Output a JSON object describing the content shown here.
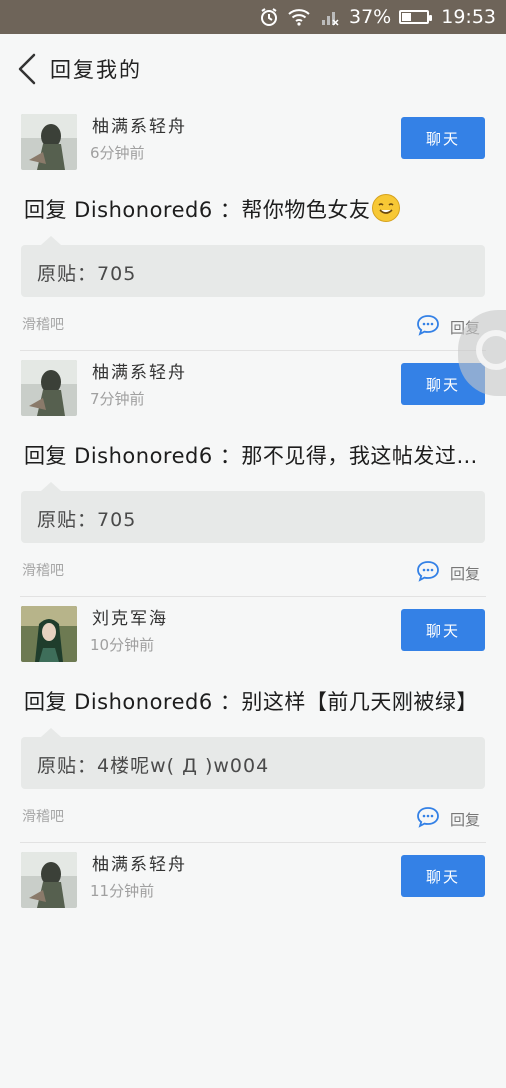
{
  "status_bar": {
    "battery_text": "37%",
    "battery_level": 0.37,
    "time": "19:53"
  },
  "header": {
    "title": "回复我的"
  },
  "items": [
    {
      "user": "柚满系轻舟",
      "time": "6分钟前",
      "chat_label": "聊天",
      "reply_prefix": "回复 Dishonored6 ：",
      "reply_body": "帮你物色女友",
      "orig_label": "原贴：",
      "orig_text": "705",
      "forum": "滑稽吧",
      "reply_label": "回复",
      "avatar": "grey"
    },
    {
      "user": "柚满系轻舟",
      "time": "7分钟前",
      "chat_label": "聊天",
      "reply_prefix": "回复 Dishonored6 ：",
      "reply_body": "那不见得，我这帖发过…",
      "orig_label": "原贴：",
      "orig_text": "705",
      "forum": "滑稽吧",
      "reply_label": "回复",
      "avatar": "grey"
    },
    {
      "user": "刘克军海",
      "time": "10分钟前",
      "chat_label": "聊天",
      "reply_prefix": "回复 Dishonored6 ：",
      "reply_body": "别这样【前几天刚被绿】",
      "orig_label": "原贴：",
      "orig_text": "4楼呢w(   Д   )w004",
      "forum": "滑稽吧",
      "reply_label": "回复",
      "avatar": "green"
    },
    {
      "user": "柚满系轻舟",
      "time": "11分钟前",
      "chat_label": "聊天",
      "reply_prefix": "",
      "reply_body": "",
      "orig_label": "",
      "orig_text": "",
      "forum": "",
      "reply_label": "",
      "avatar": "grey"
    }
  ],
  "colors": {
    "accent": "#3481e6",
    "status_bar": "#6e6459",
    "card": "#e7e9e8"
  },
  "icons": {
    "back": "chevron-left-icon",
    "alarm": "alarm-icon",
    "wifi": "wifi-icon",
    "signal": "signal-icon",
    "battery": "battery-icon",
    "comment": "comment-icon",
    "emoji": "smile-emoji-icon"
  }
}
